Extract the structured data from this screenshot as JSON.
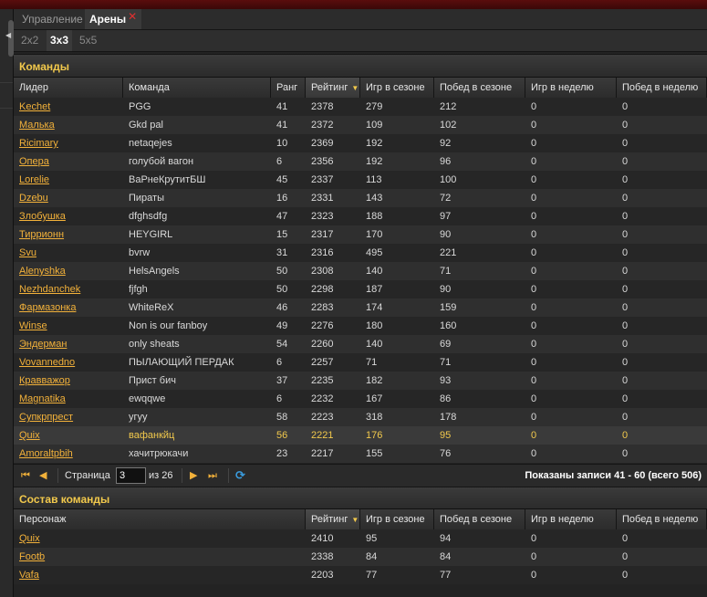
{
  "top_tabs": [
    {
      "label": "Управление",
      "active": false
    },
    {
      "label": "Арены",
      "active": true,
      "close": "✕"
    }
  ],
  "sub_tabs": [
    {
      "label": "2x2",
      "active": false
    },
    {
      "label": "3x3",
      "active": true
    },
    {
      "label": "5x5",
      "active": false
    }
  ],
  "teams": {
    "title": "Команды",
    "columns": [
      "Лидер",
      "Команда",
      "Ранг",
      "Рейтинг",
      "Игр в сезоне",
      "Побед в сезоне",
      "Игр в неделю",
      "Побед в неделю"
    ],
    "rows": [
      [
        "Kechet",
        "PGG",
        "41",
        "2378",
        "279",
        "212",
        "0",
        "0"
      ],
      [
        "Малька",
        "Gkd pal",
        "41",
        "2372",
        "109",
        "102",
        "0",
        "0"
      ],
      [
        "Ricimary",
        "netaqejes",
        "10",
        "2369",
        "192",
        "92",
        "0",
        "0"
      ],
      [
        "Опера",
        "голубой вагон",
        "6",
        "2356",
        "192",
        "96",
        "0",
        "0"
      ],
      [
        "Lorelie",
        "ВаРнеКрутитБШ",
        "45",
        "2337",
        "113",
        "100",
        "0",
        "0"
      ],
      [
        "Dzebu",
        "Пираты",
        "16",
        "2331",
        "143",
        "72",
        "0",
        "0"
      ],
      [
        "Злобушка",
        "dfghsdfg",
        "47",
        "2323",
        "188",
        "97",
        "0",
        "0"
      ],
      [
        "Тиррионн",
        "HEYGIRL",
        "15",
        "2317",
        "170",
        "90",
        "0",
        "0"
      ],
      [
        "Svu",
        "bvrw",
        "31",
        "2316",
        "495",
        "221",
        "0",
        "0"
      ],
      [
        "Alenyshka",
        "HelsAngels",
        "50",
        "2308",
        "140",
        "71",
        "0",
        "0"
      ],
      [
        "Nezhdanchek",
        "fjfgh",
        "50",
        "2298",
        "187",
        "90",
        "0",
        "0"
      ],
      [
        "Фармазонка",
        "WhiteReX",
        "46",
        "2283",
        "174",
        "159",
        "0",
        "0"
      ],
      [
        "Winse",
        "Non is our fanboy",
        "49",
        "2276",
        "180",
        "160",
        "0",
        "0"
      ],
      [
        "Эндерман",
        "only sheats",
        "54",
        "2260",
        "140",
        "69",
        "0",
        "0"
      ],
      [
        "Vovannedno",
        "ПЫЛАЮЩИЙ ПЕРДАК",
        "6",
        "2257",
        "71",
        "71",
        "0",
        "0"
      ],
      [
        "Кравважор",
        "Прист бич",
        "37",
        "2235",
        "182",
        "93",
        "0",
        "0"
      ],
      [
        "Magnatika",
        "ewqqwe",
        "6",
        "2232",
        "167",
        "86",
        "0",
        "0"
      ],
      [
        "Супкрпрест",
        "угуу",
        "58",
        "2223",
        "318",
        "178",
        "0",
        "0"
      ],
      [
        "Quix",
        "вафанкйц",
        "56",
        "2221",
        "176",
        "95",
        "0",
        "0"
      ],
      [
        "Amoraltpbih",
        "хачитрюкачи",
        "23",
        "2217",
        "155",
        "76",
        "0",
        "0"
      ]
    ],
    "selected_row": 18,
    "pager": {
      "page_label": "Страница",
      "page_value": "3",
      "of_label": "из 26",
      "info": "Показаны записи 41 - 60 (всего 506)"
    }
  },
  "roster": {
    "title": "Состав команды",
    "columns": [
      "Персонаж",
      "Рейтинг",
      "Игр в сезоне",
      "Побед в сезоне",
      "Игр в неделю",
      "Побед в неделю"
    ],
    "rows": [
      [
        "Quix",
        "2410",
        "95",
        "94",
        "0",
        "0"
      ],
      [
        "Footb",
        "2338",
        "84",
        "84",
        "0",
        "0"
      ],
      [
        "Vafa",
        "2203",
        "77",
        "77",
        "0",
        "0"
      ]
    ]
  },
  "colors": {
    "accent": "#f2b13a",
    "title": "#f2c94c",
    "close": "#e03030",
    "refresh": "#3a9de0",
    "topbar": "#5a0d0d"
  },
  "icons": {
    "first": "⏮",
    "prev": "◀",
    "next": "▶",
    "last": "⏭",
    "refresh": "⟳",
    "sort": "▼"
  }
}
